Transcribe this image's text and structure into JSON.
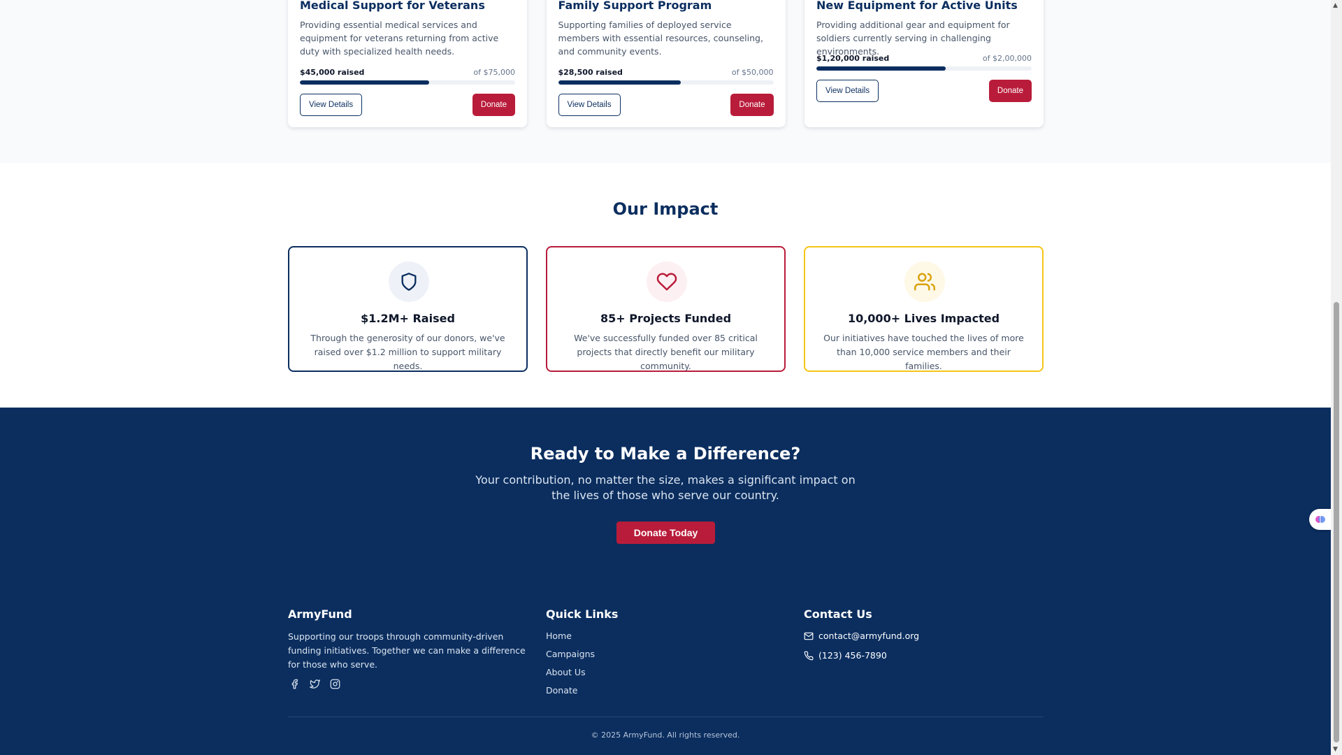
{
  "campaigns": [
    {
      "title": "Medical Support for Veterans",
      "description": "Providing essential medical services and equipment for veterans returning from active duty with specialized health needs.",
      "raised": "$45,000 raised",
      "goal": "of $75,000",
      "progress_percent": 60,
      "details_label": "View Details",
      "donate_label": "Donate"
    },
    {
      "title": "Family Support Program",
      "description": "Supporting families of deployed service members with essential resources, counseling, and community events.",
      "raised": "$28,500 raised",
      "goal": "of $50,000",
      "progress_percent": 57,
      "details_label": "View Details",
      "donate_label": "Donate"
    },
    {
      "title": "New Equipment for Active Units",
      "description": "Providing additional gear and equipment for soldiers currently serving in challenging environments.",
      "raised": "$1,20,000 raised",
      "goal": "of $2,00,000",
      "progress_percent": 60,
      "details_label": "View Details",
      "donate_label": "Donate"
    }
  ],
  "impact": {
    "title": "Our Impact",
    "cards": [
      {
        "icon": "shield-icon",
        "title": "$1.2M+ Raised",
        "description": "Through the generosity of our donors, we've raised over $1.2 million to support military needs.",
        "color": "#0b2e5f"
      },
      {
        "icon": "heart-icon",
        "title": "85+ Projects Funded",
        "description": "We've successfully funded over 85 critical projects that directly benefit our military community.",
        "color": "#b91c3a"
      },
      {
        "icon": "users-icon",
        "title": "10,000+ Lives Impacted",
        "description": "Our initiatives have touched the lives of more than 10,000 service members and their families.",
        "color": "#f5c518"
      }
    ]
  },
  "cta": {
    "title": "Ready to Make a Difference?",
    "text": "Your contribution, no matter the size, makes a significant impact on the lives of those who serve our country.",
    "button": "Donate Today"
  },
  "footer": {
    "brand": "ArmyFund",
    "tagline": "Supporting our troops through community-driven funding initiatives. Together we can make a difference for those who serve.",
    "social": [
      "facebook-icon",
      "twitter-icon",
      "instagram-icon"
    ],
    "quick_links_title": "Quick Links",
    "quick_links": [
      "Home",
      "Campaigns",
      "About Us",
      "Donate"
    ],
    "contact_title": "Contact Us",
    "email": "contact@armyfund.org",
    "phone": "(123) 456-7890",
    "copyright": "© 2025 ArmyFund. All rights reserved."
  },
  "colors": {
    "navy": "#0b2e5f",
    "red": "#b91c3a",
    "gold": "#f5c518"
  }
}
